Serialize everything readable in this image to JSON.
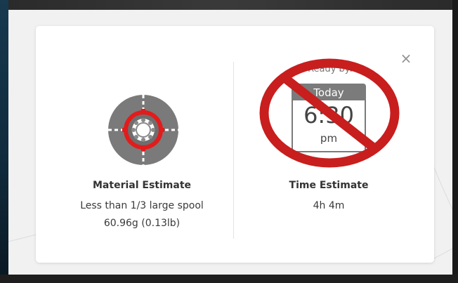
{
  "dialog": {
    "close_label": "×"
  },
  "material": {
    "icon": "spool-icon",
    "title": "Material Estimate",
    "description": "Less than 1/3 large spool",
    "weight": "60.96g (0.13lb)"
  },
  "time": {
    "ready_by_label": "Ready by:",
    "calendar_day": "Today",
    "calendar_time": "6:30",
    "calendar_ampm": "pm",
    "overlay_icon": "prohibited-sign-icon",
    "title": "Time Estimate",
    "value": "4h 4m"
  },
  "colors": {
    "prohibited_red": "#c81e1e",
    "spool_gray": "#7a7a7a",
    "spool_red": "#e31b1b"
  }
}
